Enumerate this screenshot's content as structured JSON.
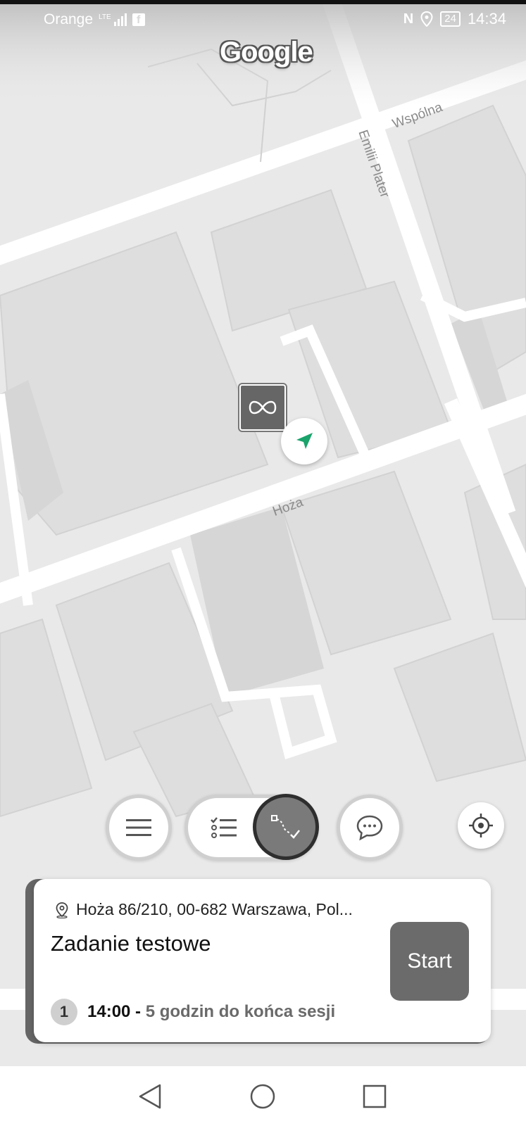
{
  "status_bar": {
    "carrier": "Orange",
    "network": "LTE",
    "battery": "24",
    "time": "14:34"
  },
  "map": {
    "provider_logo": "Google",
    "streets": {
      "wspolna": "Wspólna",
      "emilii_plater": "Emilii Plater",
      "hoza": "Hoża"
    }
  },
  "icons": {
    "pin": "infinity-pin-icon",
    "navigation": "navigation-arrow-icon",
    "menu": "hamburger-menu-icon",
    "list": "checklist-icon",
    "route": "route-icon",
    "chat": "chat-bubble-icon",
    "locate": "crosshair-icon",
    "address": "location-pin-icon"
  },
  "task_card": {
    "address": "Hoża 86/210, 00-682 Warszawa, Pol...",
    "title": "Zadanie testowe",
    "session_number": "1",
    "session_time": "14:00 -",
    "session_remaining": "5 godzin do końca sesji",
    "start_label": "Start"
  },
  "colors": {
    "navigation_arrow": "#1aa36b",
    "card_accent": "#666666",
    "start_button": "#6b6b6b"
  }
}
